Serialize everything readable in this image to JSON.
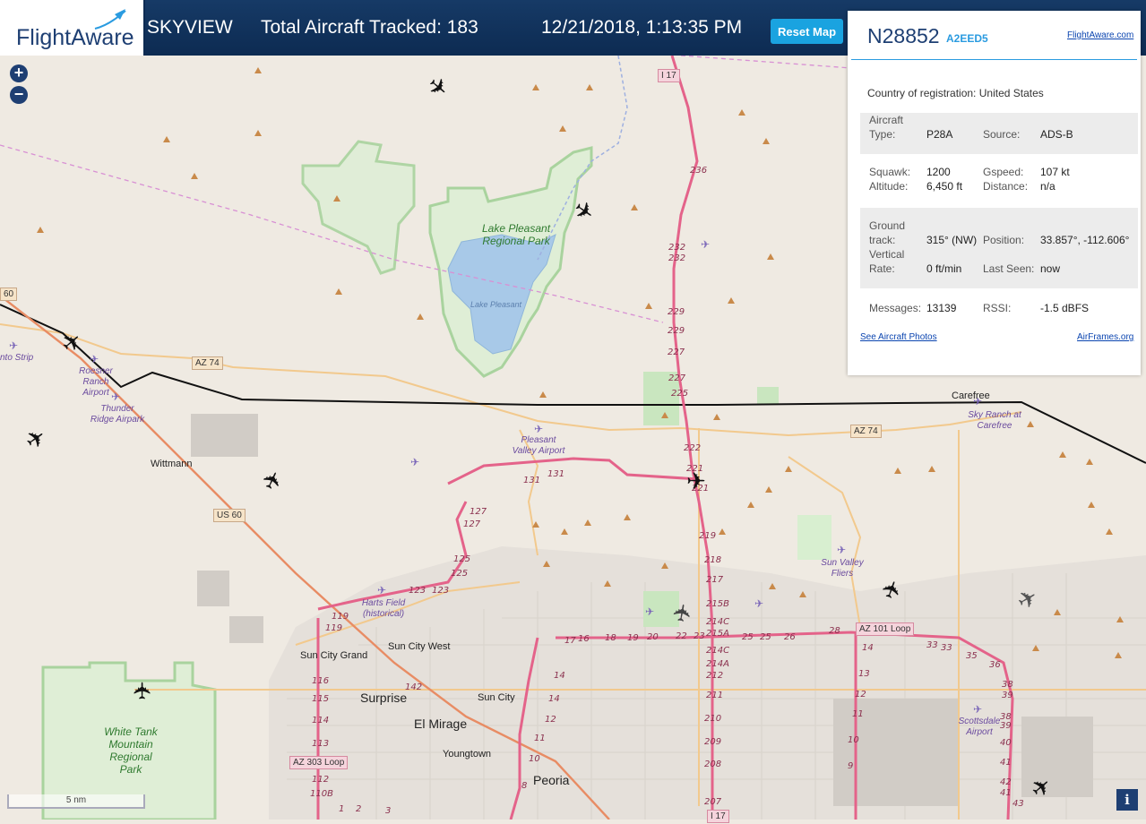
{
  "header": {
    "logo_text": "FlightAware",
    "app_name": "SKYVIEW",
    "aircraft_count": "Total Aircraft Tracked: 183",
    "datetime": "12/21/2018, 1:13:35 PM",
    "reset_label": "Reset Map"
  },
  "map_controls": {
    "zoom_in": "+",
    "zoom_out": "−",
    "scale_label": "5 nm",
    "info": "i"
  },
  "panel": {
    "registration": "N28852",
    "hex": "A2EED5",
    "flightaware_link": "FlightAware.com",
    "country_label": "Country of registration:",
    "country_value": "United States",
    "aircraft_type_label": "Aircraft Type:",
    "aircraft_type_value": "P28A",
    "source_label": "Source:",
    "source_value": "ADS-B",
    "squawk_label": "Squawk:",
    "squawk_value": "1200",
    "gspeed_label": "Gspeed:",
    "gspeed_value": "107 kt",
    "altitude_label": "Altitude:",
    "altitude_value": "6,450 ft",
    "distance_label": "Distance:",
    "distance_value": "n/a",
    "ground_track_label": "Ground track:",
    "ground_track_value": "315° (NW)",
    "position_label": "Position:",
    "position_value": "33.857°, -112.606°",
    "vertical_rate_label": "Vertical Rate:",
    "vertical_rate_value": "0 ft/min",
    "last_seen_label": "Last Seen:",
    "last_seen_value": "now",
    "messages_label": "Messages:",
    "messages_value": "13139",
    "rssi_label": "RSSI:",
    "rssi_value": "-1.5 dBFS",
    "photos_link": "See Aircraft Photos",
    "airframes_link": "AirFrames.org"
  },
  "map_labels": {
    "lake_pleasant_park": "Lake Pleasant Regional Park",
    "lake_pleasant": "Lake Pleasant",
    "white_tank_park": "White Tank Mountain Regional Park",
    "wittmann": "Wittmann",
    "carefree": "Carefree",
    "sun_city_grand": "Sun City Grand",
    "sun_city_west": "Sun City West",
    "surprise": "Surprise",
    "sun_city": "Sun City",
    "el_mirage": "El Mirage",
    "youngtown": "Youngtown",
    "peoria": "Peoria",
    "pleasant_valley_airport": "Pleasant Valley Airport",
    "roesner_ranch_airport": "Roesner Ranch Airport",
    "thunder_ridge_airpark": "Thunder Ridge Airpark",
    "sky_ranch": "Sky Ranch at Carefree",
    "sun_valley_fliers": "Sun Valley Fliers",
    "harts_field": "Harts Field (historical)",
    "scottsdale_airport": "Scottsdale Airport",
    "nto_strip": "nto Strip",
    "i17_top": "I 17",
    "i17_bottom": "I 17",
    "az74_west": "AZ 74",
    "az74_east": "AZ 74",
    "us60": "US 60",
    "road_60": "60",
    "az101": "AZ 101 Loop",
    "az303": "AZ 303 Loop"
  },
  "colors": {
    "header": "#0d2b52",
    "accent": "#1aa3e0",
    "map_bg": "#efeae2",
    "motorway": "#e4638a",
    "park": "#a9d39e"
  }
}
